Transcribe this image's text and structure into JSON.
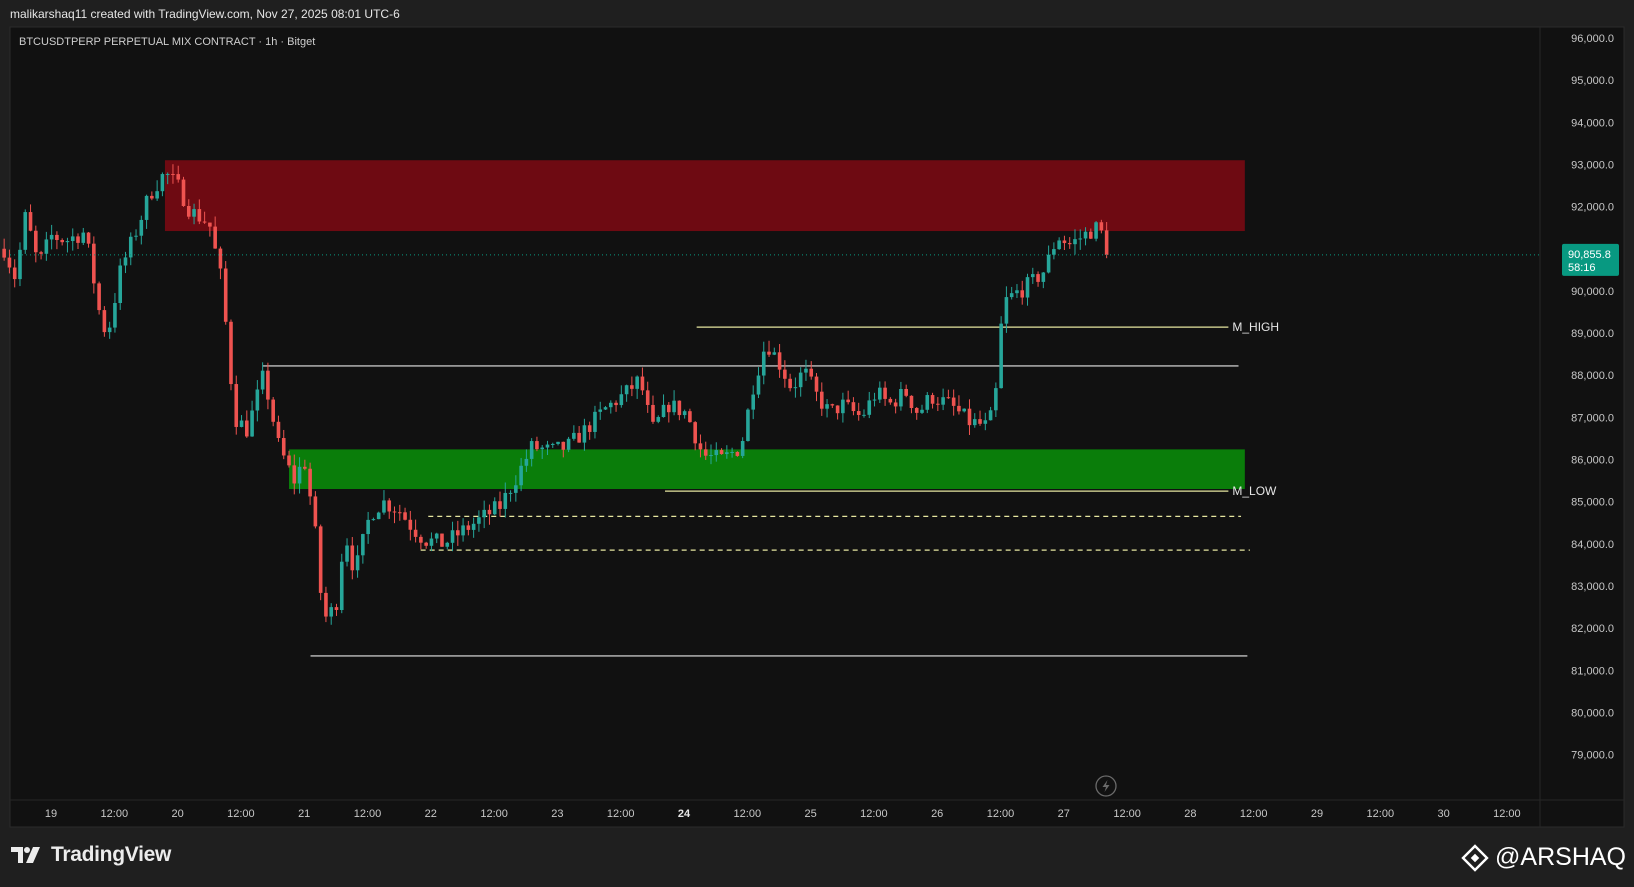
{
  "attribution": "malikarshaq11 created with TradingView.com, Nov 27, 2025 08:01 UTC-6",
  "footer": {
    "tradingview_logo_text": "TradingView",
    "watermark_text": "@ARSHAQ",
    "watermark_icon": "binance-diamond-icon"
  },
  "colors": {
    "background": "#111111",
    "frame": "#1f1f1f",
    "bull": "#26a69a",
    "bear": "#ef5350",
    "supply_zone": "#6e0a12",
    "demand_zone": "#0a7d0a",
    "level_line": "#e8e8e8",
    "m_line": "#e6e6a0",
    "price_tag": "#089981"
  },
  "chart_data": {
    "type": "candlestick",
    "title": "BTCUSDTPERP PERPETUAL MIX CONTRACT · 1h · Bitget",
    "symbol": "BTCUSDTPERP",
    "timeframe": "1h",
    "exchange": "Bitget",
    "ylim": [
      78400,
      96300
    ],
    "y_ticks": [
      {
        "value": 96000,
        "label": "96,000.0"
      },
      {
        "value": 95000,
        "label": "95,000.0"
      },
      {
        "value": 94000,
        "label": "94,000.0"
      },
      {
        "value": 93000,
        "label": "93,000.0"
      },
      {
        "value": 92000,
        "label": "92,000.0"
      },
      {
        "value": 91000,
        "label": "91,000.0"
      },
      {
        "value": 90000,
        "label": "90,000.0"
      },
      {
        "value": 89000,
        "label": "89,000.0"
      },
      {
        "value": 88000,
        "label": "88,000.0"
      },
      {
        "value": 87000,
        "label": "87,000.0"
      },
      {
        "value": 86000,
        "label": "86,000.0"
      },
      {
        "value": 85000,
        "label": "85,000.0"
      },
      {
        "value": 84000,
        "label": "84,000.0"
      },
      {
        "value": 83000,
        "label": "83,000.0"
      },
      {
        "value": 82000,
        "label": "82,000.0"
      },
      {
        "value": 81000,
        "label": "81,000.0"
      },
      {
        "value": 80000,
        "label": "80,000.0"
      },
      {
        "value": 79000,
        "label": "79,000.0"
      }
    ],
    "x_ticks": [
      {
        "day": 19.0,
        "label": "19",
        "bold": false
      },
      {
        "day": 19.5,
        "label": "12:00",
        "bold": false
      },
      {
        "day": 20.0,
        "label": "20",
        "bold": false
      },
      {
        "day": 20.5,
        "label": "12:00",
        "bold": false
      },
      {
        "day": 21.0,
        "label": "21",
        "bold": false
      },
      {
        "day": 21.5,
        "label": "12:00",
        "bold": false
      },
      {
        "day": 22.0,
        "label": "22",
        "bold": false
      },
      {
        "day": 22.5,
        "label": "12:00",
        "bold": false
      },
      {
        "day": 23.0,
        "label": "23",
        "bold": false
      },
      {
        "day": 23.5,
        "label": "12:00",
        "bold": false
      },
      {
        "day": 24.0,
        "label": "24",
        "bold": true
      },
      {
        "day": 24.5,
        "label": "12:00",
        "bold": false
      },
      {
        "day": 25.0,
        "label": "25",
        "bold": false
      },
      {
        "day": 25.5,
        "label": "12:00",
        "bold": false
      },
      {
        "day": 26.0,
        "label": "26",
        "bold": false
      },
      {
        "day": 26.5,
        "label": "12:00",
        "bold": false
      },
      {
        "day": 27.0,
        "label": "27",
        "bold": false
      },
      {
        "day": 27.5,
        "label": "12:00",
        "bold": false
      },
      {
        "day": 28.0,
        "label": "28",
        "bold": false
      },
      {
        "day": 28.5,
        "label": "12:00",
        "bold": false
      },
      {
        "day": 29.0,
        "label": "29",
        "bold": false
      },
      {
        "day": 29.5,
        "label": "12:00",
        "bold": false
      },
      {
        "day": 30.0,
        "label": "30",
        "bold": false
      },
      {
        "day": 30.5,
        "label": "12:00",
        "bold": false
      }
    ],
    "current_price": {
      "value": 90855.8,
      "label": "90,855.8",
      "countdown": "58:16"
    },
    "zones": [
      {
        "name": "supply-zone",
        "from_day": 19.9,
        "to_day": 28.43,
        "low": 91420,
        "high": 93100,
        "color": "#6e0a12"
      },
      {
        "name": "demand-zone",
        "from_day": 20.88,
        "to_day": 28.43,
        "low": 85300,
        "high": 86240,
        "color": "#0a7d0a"
      }
    ],
    "levels": [
      {
        "name": "m-high-line",
        "from_day": 24.1,
        "to_day": 28.3,
        "price": 89140,
        "style": "solid",
        "color": "#e6e6a0",
        "label": "M_HIGH"
      },
      {
        "name": "range-high-line",
        "from_day": 20.67,
        "to_day": 28.38,
        "price": 88220,
        "style": "solid",
        "color": "#e8e8e8",
        "label": ""
      },
      {
        "name": "m-low-line",
        "from_day": 23.85,
        "to_day": 28.3,
        "price": 85250,
        "style": "solid",
        "color": "#e6e6a0",
        "label": "M_LOW"
      },
      {
        "name": "dashed-level-upper",
        "from_day": 21.98,
        "to_day": 28.4,
        "price": 84650,
        "style": "dashed",
        "color": "#e6e6a0",
        "label": ""
      },
      {
        "name": "dashed-level-lower",
        "from_day": 21.92,
        "to_day": 28.47,
        "price": 83850,
        "style": "dashed",
        "color": "#e6e6a0",
        "label": ""
      },
      {
        "name": "range-low-line",
        "from_day": 21.05,
        "to_day": 28.45,
        "price": 81340,
        "style": "solid",
        "color": "#e8e8e8",
        "label": ""
      }
    ],
    "price_path": [
      {
        "day": 18.63,
        "price": 91000
      },
      {
        "day": 18.72,
        "price": 90300
      },
      {
        "day": 18.8,
        "price": 91800
      },
      {
        "day": 18.9,
        "price": 90600
      },
      {
        "day": 19.0,
        "price": 91300
      },
      {
        "day": 19.12,
        "price": 91200
      },
      {
        "day": 19.27,
        "price": 91400
      },
      {
        "day": 19.4,
        "price": 89200
      },
      {
        "day": 19.45,
        "price": 89000
      },
      {
        "day": 19.55,
        "price": 90500
      },
      {
        "day": 19.67,
        "price": 91400
      },
      {
        "day": 19.78,
        "price": 92300
      },
      {
        "day": 19.9,
        "price": 92800
      },
      {
        "day": 20.0,
        "price": 92500
      },
      {
        "day": 20.1,
        "price": 91900
      },
      {
        "day": 20.25,
        "price": 91600
      },
      {
        "day": 20.35,
        "price": 90200
      },
      {
        "day": 20.45,
        "price": 87000
      },
      {
        "day": 20.55,
        "price": 86700
      },
      {
        "day": 20.68,
        "price": 88000
      },
      {
        "day": 20.8,
        "price": 86300
      },
      {
        "day": 20.92,
        "price": 85500
      },
      {
        "day": 21.0,
        "price": 86000
      },
      {
        "day": 21.08,
        "price": 84500
      },
      {
        "day": 21.15,
        "price": 82200
      },
      {
        "day": 21.25,
        "price": 82500
      },
      {
        "day": 21.32,
        "price": 84300
      },
      {
        "day": 21.4,
        "price": 83300
      },
      {
        "day": 21.52,
        "price": 84700
      },
      {
        "day": 21.62,
        "price": 85000
      },
      {
        "day": 21.75,
        "price": 84800
      },
      {
        "day": 21.85,
        "price": 84400
      },
      {
        "day": 21.95,
        "price": 84100
      },
      {
        "day": 22.1,
        "price": 84000
      },
      {
        "day": 22.25,
        "price": 84300
      },
      {
        "day": 22.4,
        "price": 84600
      },
      {
        "day": 22.55,
        "price": 84900
      },
      {
        "day": 22.68,
        "price": 85600
      },
      {
        "day": 22.8,
        "price": 86300
      },
      {
        "day": 22.95,
        "price": 86200
      },
      {
        "day": 23.08,
        "price": 86300
      },
      {
        "day": 23.22,
        "price": 86700
      },
      {
        "day": 23.38,
        "price": 87200
      },
      {
        "day": 23.55,
        "price": 87600
      },
      {
        "day": 23.65,
        "price": 87900
      },
      {
        "day": 23.75,
        "price": 86700
      },
      {
        "day": 23.88,
        "price": 87300
      },
      {
        "day": 24.02,
        "price": 87100
      },
      {
        "day": 24.15,
        "price": 86100
      },
      {
        "day": 24.3,
        "price": 86000
      },
      {
        "day": 24.45,
        "price": 86300
      },
      {
        "day": 24.55,
        "price": 87800
      },
      {
        "day": 24.65,
        "price": 88800
      },
      {
        "day": 24.75,
        "price": 88300
      },
      {
        "day": 24.85,
        "price": 87700
      },
      {
        "day": 24.95,
        "price": 88100
      },
      {
        "day": 25.05,
        "price": 87500
      },
      {
        "day": 25.15,
        "price": 87100
      },
      {
        "day": 25.25,
        "price": 87300
      },
      {
        "day": 25.4,
        "price": 87000
      },
      {
        "day": 25.52,
        "price": 87600
      },
      {
        "day": 25.62,
        "price": 87300
      },
      {
        "day": 25.75,
        "price": 87600
      },
      {
        "day": 25.85,
        "price": 87100
      },
      {
        "day": 25.95,
        "price": 87500
      },
      {
        "day": 26.1,
        "price": 87300
      },
      {
        "day": 26.25,
        "price": 86900
      },
      {
        "day": 26.38,
        "price": 86800
      },
      {
        "day": 26.45,
        "price": 87100
      },
      {
        "day": 26.52,
        "price": 89700
      },
      {
        "day": 26.6,
        "price": 89900
      },
      {
        "day": 26.75,
        "price": 90200
      },
      {
        "day": 26.85,
        "price": 90500
      },
      {
        "day": 26.95,
        "price": 91300
      },
      {
        "day": 27.05,
        "price": 91100
      },
      {
        "day": 27.15,
        "price": 91300
      },
      {
        "day": 27.25,
        "price": 91500
      },
      {
        "day": 27.32,
        "price": 91300
      },
      {
        "day": 27.37,
        "price": 90855.8
      }
    ]
  }
}
